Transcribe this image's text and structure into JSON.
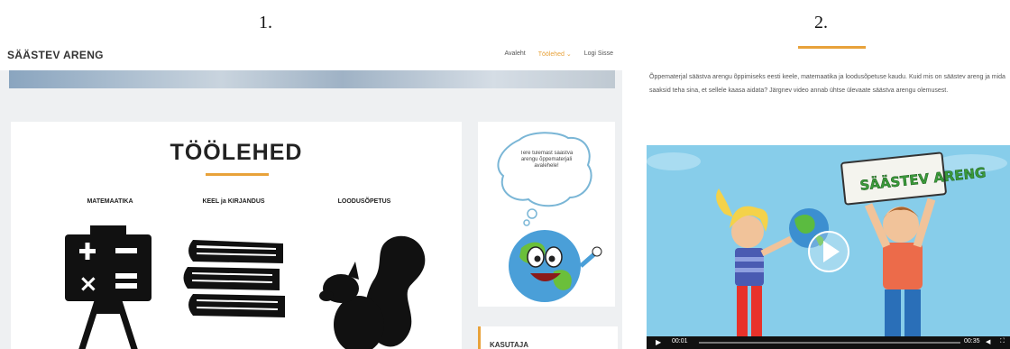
{
  "figure": {
    "label1": "1.",
    "label2": "2."
  },
  "site": {
    "brand": "SÄÄSTEV ARENG",
    "nav": [
      "Avaleht",
      "Töölehed ⌄",
      "Logi Sisse"
    ]
  },
  "main": {
    "title": "TÖÖLEHED",
    "subjects": [
      "MATEMAATIKA",
      "KEEL ja KIRJANDUS",
      "LOODUSÕPETUS"
    ]
  },
  "sidebar": {
    "bubble_text": "Tere tulemast säästva arengu õppematerjali avalehele!",
    "section_label": "KASUTAJA"
  },
  "page2": {
    "intro": "Õppematerjal säästva arengu õppimiseks eesti keele, matemaatika ja loodusõpetuse kaudu. Kuid mis on säästev areng ja mida saaksid teha sina, et sellele kaasa aidata? Järgnev video annab ühtse ülevaate säästva arengu olemusest.",
    "video_banner": "SÄÄSTEV ARENG",
    "time_current": "00:01",
    "time_total": "00:35"
  },
  "colors": {
    "accent": "#e8a23a",
    "video_bg": "#87cdea"
  },
  "icons": [
    "math-chalkboard-icon",
    "books-stack-icon",
    "squirrel-icon",
    "play-icon",
    "volume-icon",
    "fullscreen-icon"
  ]
}
